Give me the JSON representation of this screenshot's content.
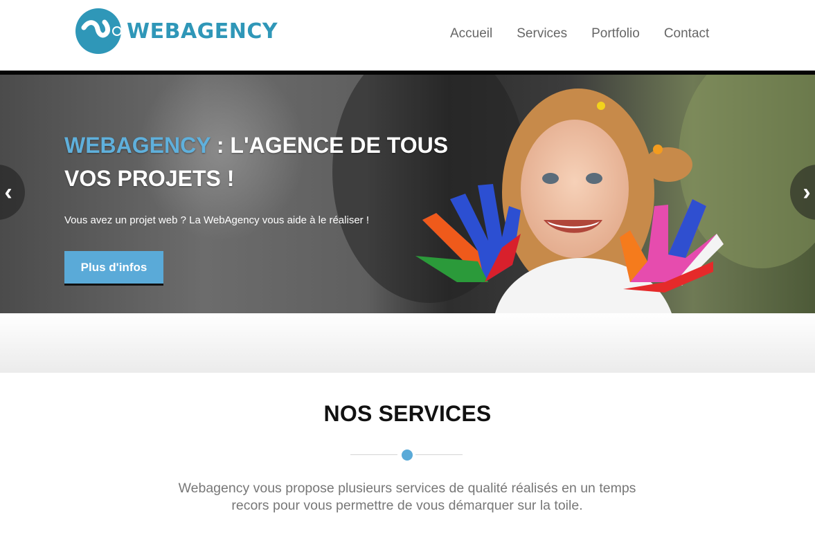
{
  "header": {
    "brand": "WEBAGENCY",
    "nav": [
      "Accueil",
      "Services",
      "Portfolio",
      "Contact"
    ]
  },
  "hero": {
    "title_brand": "WEBAGENCY",
    "title_rest": " : L'AGENCE DE TOUS VOS PROJETS !",
    "subtitle": "Vous avez un projet web ? La WebAgency vous aide à le réaliser !",
    "button": "Plus d'infos",
    "prev_icon": "chevron-left-icon",
    "next_icon": "chevron-right-icon"
  },
  "services": {
    "title": "NOS SERVICES",
    "description": "Webagency vous propose plusieurs services de qualité réalisés en un temps recors pour vous permettre de vous démarquer sur la toile."
  },
  "colors": {
    "accent": "#5aaad8",
    "brand": "#2f97b8"
  }
}
